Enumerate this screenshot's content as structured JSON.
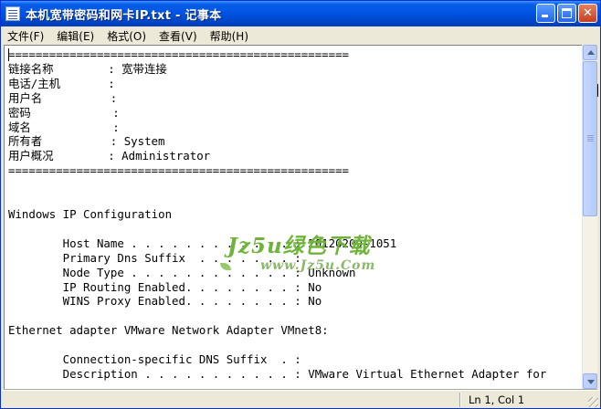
{
  "window": {
    "title": "本机宽带密码和网卡IP.txt - 记事本"
  },
  "menu": {
    "items": [
      {
        "label": "文件(F)"
      },
      {
        "label": "编辑(E)"
      },
      {
        "label": "格式(O)"
      },
      {
        "label": "查看(V)"
      },
      {
        "label": "帮助(H)"
      }
    ]
  },
  "editor": {
    "content": "==================================================\n链接名称        : 宽带连接\n电话/主机       :\n用户名          :\n密码            :\n域名            :\n所有者          : System\n用户概况        : Administrator\n==================================================\n\n\nWindows IP Configuration\n\n        Host Name . . . . . . . . . . . . : 20120209-1051\n        Primary Dns Suffix  . . . . . . . :\n        Node Type . . . . . . . . . . . . : Unknown\n        IP Routing Enabled. . . . . . . . : No\n        WINS Proxy Enabled. . . . . . . . : No\n\nEthernet adapter VMware Network Adapter VMnet8:\n\n        Connection-specific DNS Suffix  . :\n        Description . . . . . . . . . . . : VMware Virtual Ethernet Adapter for"
  },
  "watermark": {
    "line1": "Jz5u绿色下载",
    "line2": "www.Jz5u.Com"
  },
  "status": {
    "position": "Ln 1, Col 1"
  },
  "colors": {
    "titlebar": "#0054e3",
    "chrome": "#ece9d8",
    "watermark": "#6fb43a"
  }
}
